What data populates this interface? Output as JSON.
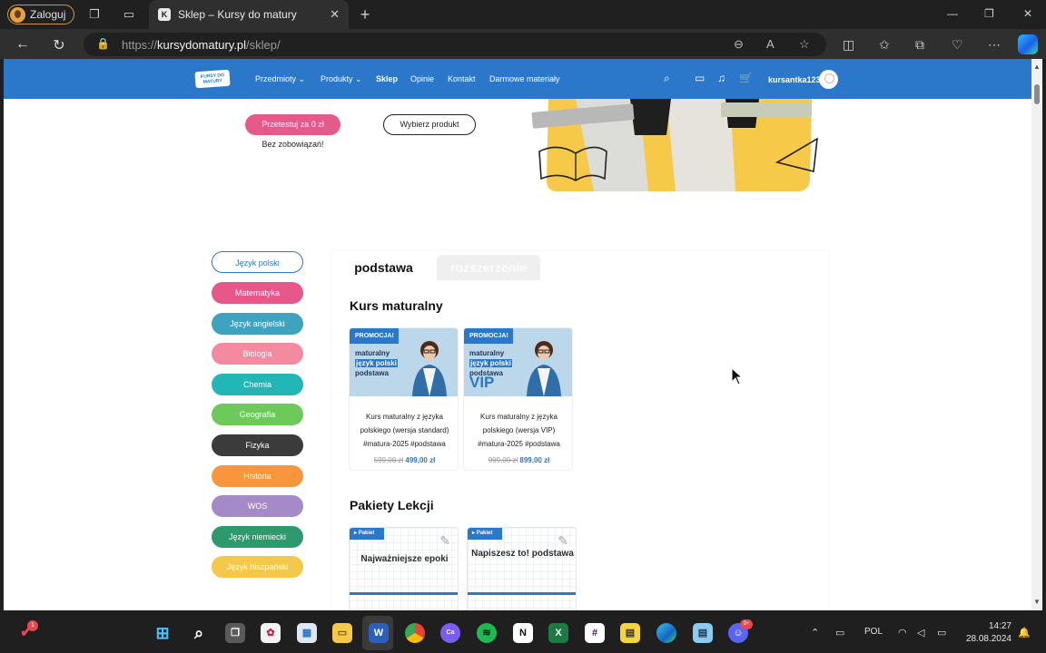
{
  "browser": {
    "profile_label": "Zaloguj",
    "tab_title": "Sklep – Kursy do matury",
    "tab_favicon": "K",
    "url_prefix": "https://",
    "url_domain": "kursydomatury.pl",
    "url_path": "/sklep/"
  },
  "site_nav": {
    "logo_text": "KURSY DO MATURY",
    "items": [
      {
        "label": "Przedmioty"
      },
      {
        "label": "Produkty"
      },
      {
        "label": "Sklep"
      },
      {
        "label": "Opinie"
      },
      {
        "label": "Kontakt"
      },
      {
        "label": "Darmowe materiały"
      }
    ],
    "username": "kursantka123"
  },
  "hero": {
    "try_button": "Przetestuj za 0 zł",
    "no_commitment": "Bez zobowiązań!",
    "choose_button": "Wybierz produkt"
  },
  "categories": [
    {
      "label": "Język polski",
      "color": "#ffffff"
    },
    {
      "label": "Matematyka",
      "color": "#e8578a"
    },
    {
      "label": "Język angielski",
      "color": "#3fa3c0"
    },
    {
      "label": "Biologia",
      "color": "#f48aa0"
    },
    {
      "label": "Chemia",
      "color": "#22b6b6"
    },
    {
      "label": "Geografia",
      "color": "#6cc95a"
    },
    {
      "label": "Fizyka",
      "color": "#3b3b3b"
    },
    {
      "label": "Historia",
      "color": "#f7963c"
    },
    {
      "label": "WOS",
      "color": "#a48bc7"
    },
    {
      "label": "Język niemiecki",
      "color": "#2d9a6e"
    },
    {
      "label": "Język hiszpański",
      "color": "#f5c84a"
    }
  ],
  "level_tabs": {
    "active": "podstawa",
    "inactive": "rozszerzenie"
  },
  "section_course": {
    "title": "Kurs maturalny",
    "products": [
      {
        "badge": "PROMOCJA!",
        "thumb_line1": "maturalny",
        "thumb_line2": "język polski",
        "thumb_line3": "podstawa",
        "description": "Kurs maturalny z języka polskiego (wersja standard) #matura-2025 #podstawa",
        "old_price": "599,00 zł",
        "price": "499,00 zł"
      },
      {
        "badge": "PROMOCJA!",
        "thumb_line1": "maturalny",
        "thumb_line2": "język polski",
        "thumb_line3": "podstawa",
        "thumb_vip": "VIP",
        "description": "Kurs maturalny z języka polskiego (wersja VIP) #matura-2025 #podstawa",
        "old_price": "999,00 zł",
        "price": "899,00 zł"
      }
    ]
  },
  "section_packages": {
    "title": "Pakiety Lekcji",
    "items": [
      {
        "badge": "Pakiet",
        "title": "Najważniejsze epoki"
      },
      {
        "badge": "Pakiet",
        "title": "Napiszesz to! podstawa"
      }
    ]
  },
  "taskbar": {
    "notification_count": "1",
    "discord_badge": "9+",
    "language": "POL",
    "time": "14:27",
    "date": "28.08.2024"
  }
}
